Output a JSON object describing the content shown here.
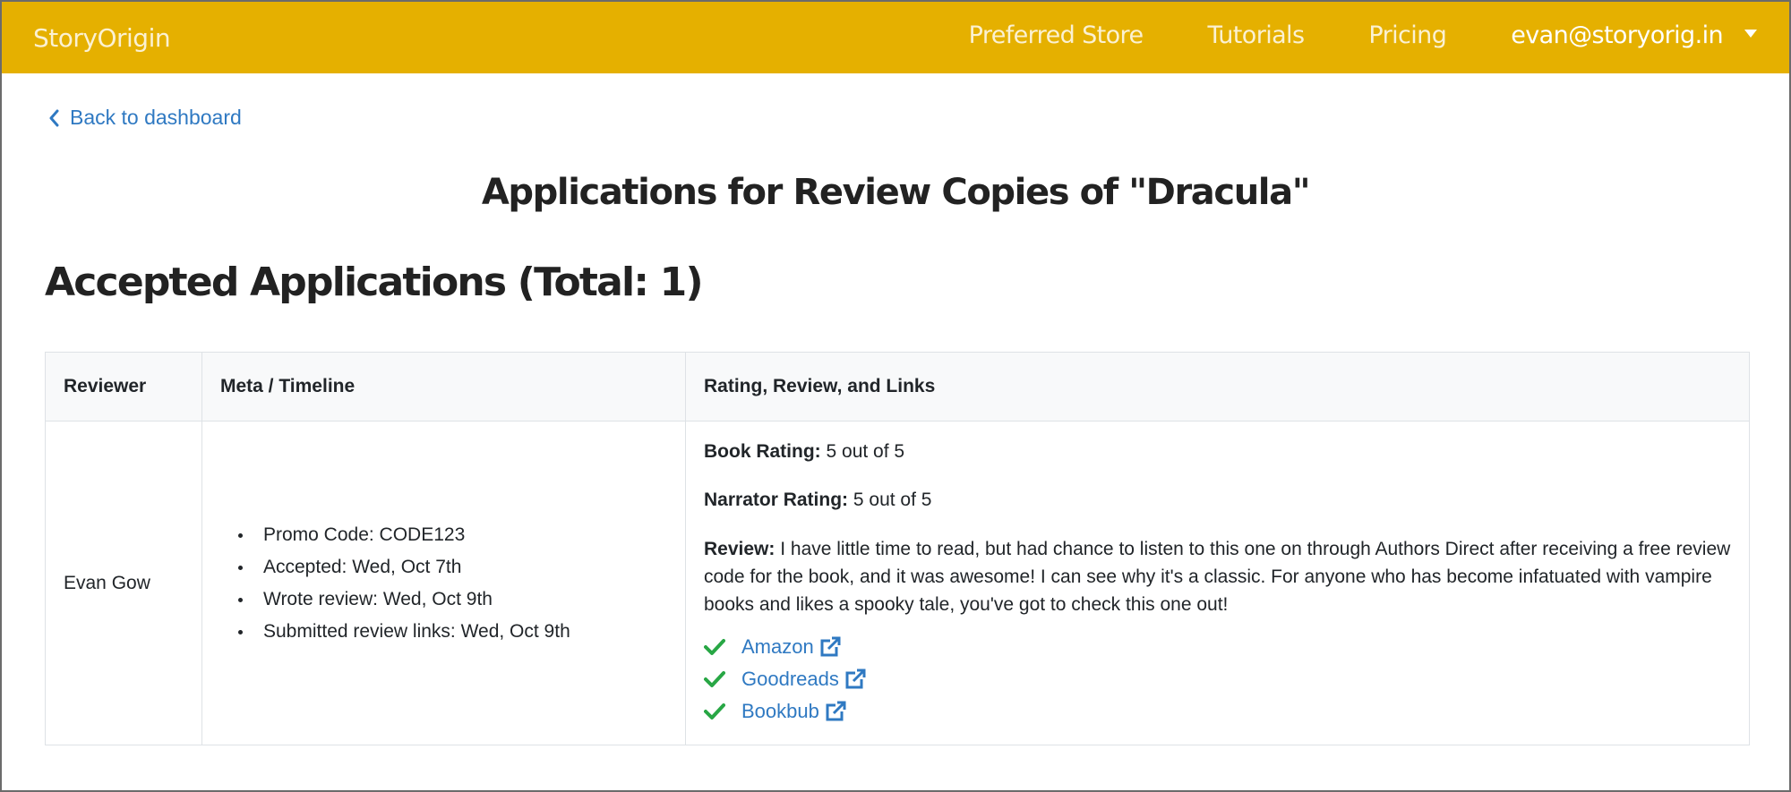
{
  "navbar": {
    "brand": "StoryOrigin",
    "links": [
      {
        "label": "Preferred Store"
      },
      {
        "label": "Tutorials"
      },
      {
        "label": "Pricing"
      }
    ],
    "user": {
      "email": "evan@storyorig.in",
      "icon": "caret-down-icon"
    },
    "color": "#e5b000"
  },
  "back_link": {
    "label": "Back to dashboard",
    "icon": "chevron-left-icon"
  },
  "page_title": "Applications for Review Copies of \"Dracula\"",
  "section_title": "Accepted Applications (Total: 1)",
  "table": {
    "headers": [
      "Reviewer",
      "Meta / Timeline",
      "Rating, Review, and Links"
    ],
    "rows": [
      {
        "reviewer": "Evan Gow",
        "meta": [
          "Promo Code: CODE123",
          "Accepted: Wed, Oct 7th",
          "Wrote review: Wed, Oct 9th",
          "Submitted review links: Wed, Oct 9th"
        ],
        "book_rating_label": "Book Rating:",
        "book_rating_value": "5 out of 5",
        "narrator_rating_label": "Narrator Rating:",
        "narrator_rating_value": "5 out of 5",
        "review_label": "Review:",
        "review_text": "I have little time to read, but had chance to listen to this one on through Authors Direct after receiving a free review code for the book, and it was awesome! I can see why it's a classic. For anyone who has become infatuated with vampire books and likes a spooky tale, you've got to check this one out!",
        "links": [
          {
            "label": "Amazon",
            "status_icon": "check-icon",
            "link_icon": "external-link-icon"
          },
          {
            "label": "Goodreads",
            "status_icon": "check-icon",
            "link_icon": "external-link-icon"
          },
          {
            "label": "Bookbub",
            "status_icon": "check-icon",
            "link_icon": "external-link-icon"
          }
        ]
      }
    ]
  },
  "colors": {
    "link": "#2f79c2",
    "check": "#28a745",
    "header_bg": "#f8f9fa"
  }
}
